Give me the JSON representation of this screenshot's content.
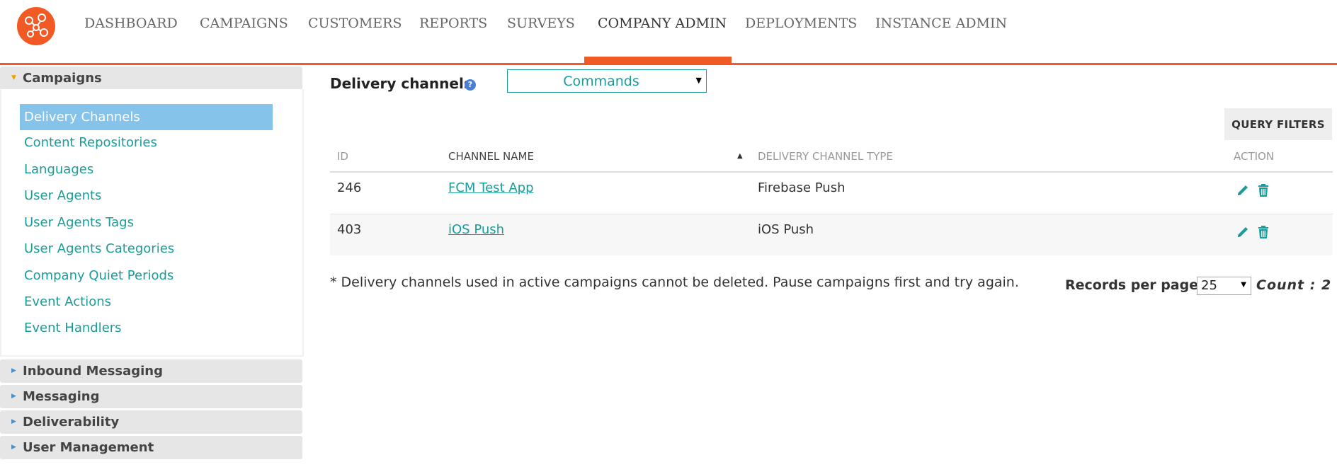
{
  "topnav": {
    "items": [
      {
        "label": "DASHBOARD"
      },
      {
        "label": "CAMPAIGNS"
      },
      {
        "label": "CUSTOMERS"
      },
      {
        "label": "REPORTS"
      },
      {
        "label": "SURVEYS"
      },
      {
        "label": "COMPANY ADMIN",
        "active": true
      },
      {
        "label": "DEPLOYMENTS"
      },
      {
        "label": "INSTANCE ADMIN"
      }
    ]
  },
  "sidebar": {
    "sections": [
      {
        "label": "Campaigns",
        "expanded": true,
        "items": [
          {
            "label": "Delivery Channels",
            "active": true
          },
          {
            "label": "Content Repositories"
          },
          {
            "label": "Languages"
          },
          {
            "label": "User Agents"
          },
          {
            "label": "User Agents Tags"
          },
          {
            "label": "User Agents Categories"
          },
          {
            "label": "Company Quiet Periods"
          },
          {
            "label": "Event Actions"
          },
          {
            "label": "Event Handlers"
          }
        ]
      },
      {
        "label": "Inbound Messaging",
        "expanded": false
      },
      {
        "label": "Messaging",
        "expanded": false
      },
      {
        "label": "Deliverability",
        "expanded": false
      },
      {
        "label": "User Management",
        "expanded": false
      }
    ]
  },
  "main": {
    "title": "Delivery channels",
    "help_glyph": "?",
    "channel_filter": {
      "selected": "Commands"
    },
    "query_filters_label": "QUERY FILTERS",
    "table": {
      "columns": [
        "ID",
        "CHANNEL NAME",
        "DELIVERY CHANNEL TYPE",
        "ACTION"
      ],
      "sorted_column": "CHANNEL NAME",
      "sort_direction": "ascending",
      "rows": [
        {
          "id": "246",
          "name": "FCM Test App",
          "type": "Firebase Push"
        },
        {
          "id": "403",
          "name": "iOS Push",
          "type": "iOS Push"
        }
      ]
    },
    "footnote": "* Delivery channels used in active campaigns cannot be deleted. Pause campaigns first and try again.",
    "records_per_page_label": "Records per page",
    "records_per_page": "25",
    "count_text": "Count : 2"
  },
  "colors": {
    "accent_orange": "#f15a24",
    "link_teal": "#1a9c9a",
    "active_sidebar_blue": "#85c3ea"
  },
  "icons": {
    "logo": "network-nodes-logo",
    "help": "question-circle-icon",
    "edit": "pencil-icon",
    "delete": "trash-icon",
    "sort": "sort-up-triangle-icon"
  }
}
